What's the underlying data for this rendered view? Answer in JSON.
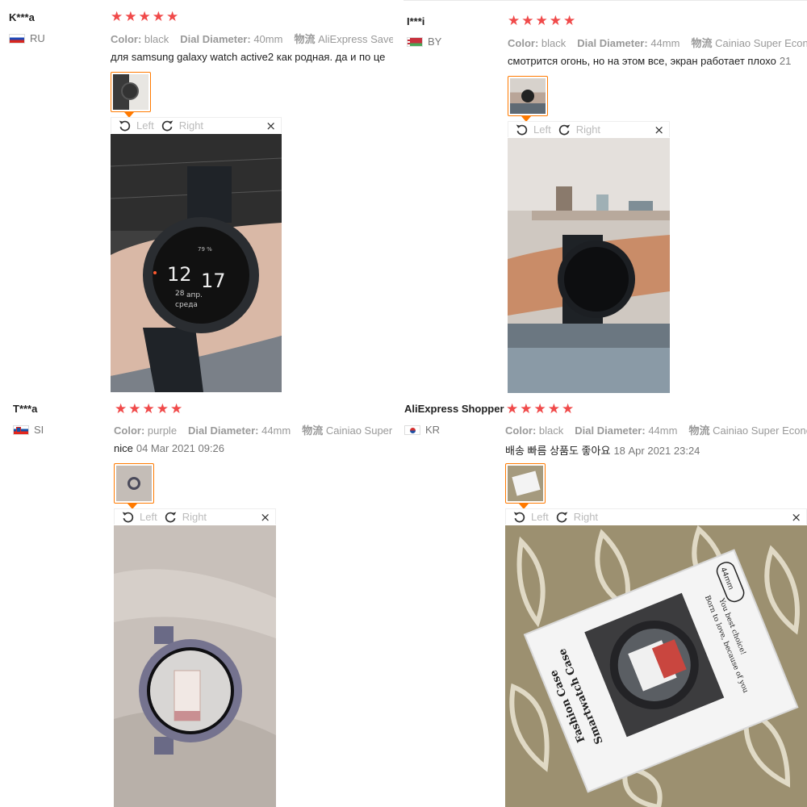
{
  "common": {
    "color_label": "Color:",
    "diameter_label": "Dial Diameter:",
    "logistics_label": "物流",
    "rotate_left": "Left",
    "rotate_right": "Right",
    "close_symbol": "×",
    "star_color": "#f04a4a",
    "accent": "#ff7a00"
  },
  "reviews": [
    {
      "user": "K***a",
      "country": "RU",
      "rating": 5,
      "color": "black",
      "diameter": "40mm",
      "logistics": "AliExpress Saver Shipping",
      "text": "для samsung galaxy watch active2 как родная. да и по це",
      "date": "",
      "watch_face": {
        "time_h": "12",
        "time_m": "17",
        "battery": "79 %",
        "day": "28",
        "month": "апр.",
        "weekday": "среда"
      }
    },
    {
      "user": "I***i",
      "country": "BY",
      "rating": 5,
      "color": "black",
      "diameter": "44mm",
      "logistics": "Cainiao Super Economy",
      "text": "смотрится огонь, но на этом все, экран работает плохо",
      "date": "21"
    },
    {
      "user": "T***a",
      "country": "SI",
      "rating": 5,
      "color": "purple",
      "diameter": "44mm",
      "logistics": "Cainiao Super Economy",
      "text": "nice",
      "date": "04 Mar 2021 09:26"
    },
    {
      "user": "AliExpress Shopper",
      "country": "KR",
      "rating": 5,
      "color": "black",
      "diameter": "44mm",
      "logistics": "Cainiao Super Economy",
      "text": "배송 빠름 상품도 좋아요",
      "date": "18 Apr 2021 23:24",
      "package": {
        "line1": "Fashion Case",
        "line2": "Smartwatch Case",
        "line3": "Born to love, because of you",
        "line4": "You best choice!",
        "size": "44mm"
      }
    }
  ]
}
